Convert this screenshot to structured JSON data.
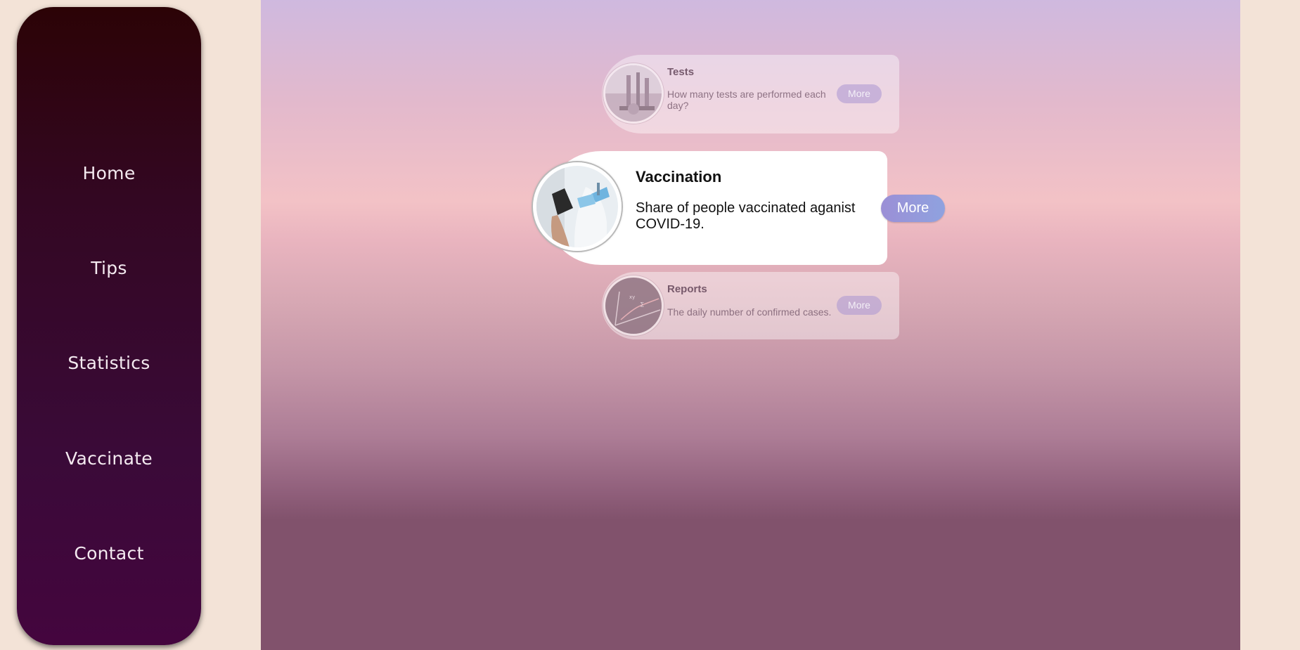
{
  "nav": {
    "items": [
      {
        "label": "Home"
      },
      {
        "label": "Tips"
      },
      {
        "label": "Statistics"
      },
      {
        "label": "Vaccinate"
      },
      {
        "label": "Contact"
      }
    ]
  },
  "cards": {
    "tests": {
      "title": "Tests",
      "description": "How many tests are performed each day?",
      "button": "More"
    },
    "vaccination": {
      "title": "Vaccination",
      "description": "Share of people vaccinated aganist COVID-19.",
      "button": "More"
    },
    "reports": {
      "title": "Reports",
      "description": "The daily number of confirmed cases.",
      "button": "More"
    }
  },
  "colors": {
    "sidebar_top": "#2c0306",
    "sidebar_bottom": "#44053e",
    "page_bg": "#f3e3d7",
    "accent_button": "#9b8fd6"
  }
}
